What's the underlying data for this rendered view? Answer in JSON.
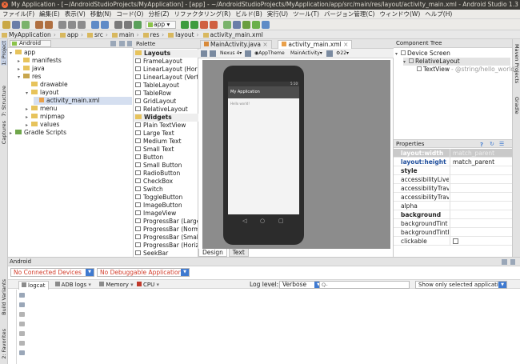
{
  "window": {
    "close_glyph": "×",
    "title": "My Application - [~/AndroidStudioProjects/MyApplication] - [app] - ~/AndroidStudioProjects/MyApplication/app/src/main/res/layout/activity_main.xml - Android Studio 1.3"
  },
  "menu": [
    "ファイル(F)",
    "編集(E)",
    "表示(V)",
    "移動(N)",
    "コード(O)",
    "分析(Z)",
    "リファクタリング(R)",
    "ビルド(B)",
    "実行(U)",
    "ツール(T)",
    "バージョン管理(C)",
    "ウィンドウ(W)",
    "ヘルプ(H)"
  ],
  "toolbar": {
    "run_config": "app",
    "run_config_arrow": "▾"
  },
  "breadcrumb": [
    "MyApplication",
    "app",
    "src",
    "main",
    "res",
    "layout",
    "activity_main.xml"
  ],
  "left_strip": {
    "top": [
      "1: Project",
      "7: Structure",
      "Captures"
    ],
    "bottom": [
      "Build Variants",
      "2: Favorites"
    ]
  },
  "right_strip": [
    "Maven Projects",
    "Gradle"
  ],
  "project": {
    "view_selector": "Android",
    "tree": [
      {
        "label": "app",
        "depth": 0,
        "arrow": "▾",
        "kind": "module"
      },
      {
        "label": "manifests",
        "depth": 1,
        "arrow": "▸",
        "kind": "folder"
      },
      {
        "label": "java",
        "depth": 1,
        "arrow": "▸",
        "kind": "folder"
      },
      {
        "label": "res",
        "depth": 1,
        "arrow": "▾",
        "kind": "res"
      },
      {
        "label": "drawable",
        "depth": 2,
        "arrow": "",
        "kind": "folder"
      },
      {
        "label": "layout",
        "depth": 2,
        "arrow": "▾",
        "kind": "folder"
      },
      {
        "label": "activity_main.xml",
        "depth": 3,
        "arrow": "",
        "kind": "file",
        "selected": true
      },
      {
        "label": "menu",
        "depth": 2,
        "arrow": "▸",
        "kind": "folder"
      },
      {
        "label": "mipmap",
        "depth": 2,
        "arrow": "▸",
        "kind": "folder"
      },
      {
        "label": "values",
        "depth": 2,
        "arrow": "▸",
        "kind": "folder"
      },
      {
        "label": "Gradle Scripts",
        "depth": 0,
        "arrow": "▸",
        "kind": "gradle"
      }
    ]
  },
  "palette": {
    "title": "Palette",
    "items": [
      {
        "label": "Layouts",
        "header": true
      },
      {
        "label": "FrameLayout"
      },
      {
        "label": "LinearLayout (Horizontal)"
      },
      {
        "label": "LinearLayout (Vertical)"
      },
      {
        "label": "TableLayout"
      },
      {
        "label": "TableRow"
      },
      {
        "label": "GridLayout"
      },
      {
        "label": "RelativeLayout"
      },
      {
        "label": "Widgets",
        "header": true
      },
      {
        "label": "Plain TextView"
      },
      {
        "label": "Large Text"
      },
      {
        "label": "Medium Text"
      },
      {
        "label": "Small Text"
      },
      {
        "label": "Button"
      },
      {
        "label": "Small Button"
      },
      {
        "label": "RadioButton"
      },
      {
        "label": "CheckBox"
      },
      {
        "label": "Switch"
      },
      {
        "label": "ToggleButton"
      },
      {
        "label": "ImageButton"
      },
      {
        "label": "ImageView"
      },
      {
        "label": "ProgressBar (Large)"
      },
      {
        "label": "ProgressBar (Normal)"
      },
      {
        "label": "ProgressBar (Small)"
      },
      {
        "label": "ProgressBar (Horizontal)"
      },
      {
        "label": "SeekBar"
      }
    ]
  },
  "editor": {
    "tabs": [
      {
        "label": "MainActivity.java",
        "active": false
      },
      {
        "label": "activity_main.xml",
        "active": true
      }
    ],
    "device": "Nexus 4",
    "theme": "AppTheme",
    "activity": "MainActivity",
    "api": "22",
    "preview": {
      "time": "5:10",
      "app_title": "My Application",
      "hello": "Hello world!"
    },
    "mode_tabs": [
      "Design",
      "Text"
    ],
    "active_mode": "Design"
  },
  "component_tree": {
    "title": "Component Tree",
    "items": [
      {
        "label": "Device Screen",
        "depth": 0
      },
      {
        "label": "RelativeLayout",
        "depth": 1
      },
      {
        "label": "TextView",
        "detail": "- @string/hello_world",
        "depth": 2
      }
    ]
  },
  "properties": {
    "title": "Properties",
    "rows": [
      {
        "name": "layout:width",
        "value": "match_parent",
        "bold": true,
        "highlight": true
      },
      {
        "name": "layout:height",
        "value": "match_parent",
        "bold": true
      },
      {
        "name": "style",
        "value": "",
        "bold": true
      },
      {
        "name": "accessibilityLiveRegion",
        "value": ""
      },
      {
        "name": "accessibilityTraversalAfter",
        "value": ""
      },
      {
        "name": "accessibilityTraversalBefore",
        "value": ""
      },
      {
        "name": "alpha",
        "value": ""
      },
      {
        "name": "background",
        "value": "",
        "bold": true
      },
      {
        "name": "backgroundTint",
        "value": ""
      },
      {
        "name": "backgroundTintMode",
        "value": ""
      },
      {
        "name": "clickable",
        "value": "",
        "checkbox": true
      }
    ]
  },
  "android_panel": {
    "title": "Android",
    "devices": "No Connected Devices",
    "apps": "No Debuggable Applications",
    "tabs": [
      "logcat",
      "ADB logs",
      "Memory",
      "CPU"
    ],
    "log_level_label": "Log level:",
    "log_level": "Verbose",
    "search_placeholder": "Q-",
    "filter": "Show only selected application"
  },
  "colors": {
    "accent": "#3f7ad0",
    "error_text": "#d23c2a",
    "selection": "#d5dff0"
  }
}
